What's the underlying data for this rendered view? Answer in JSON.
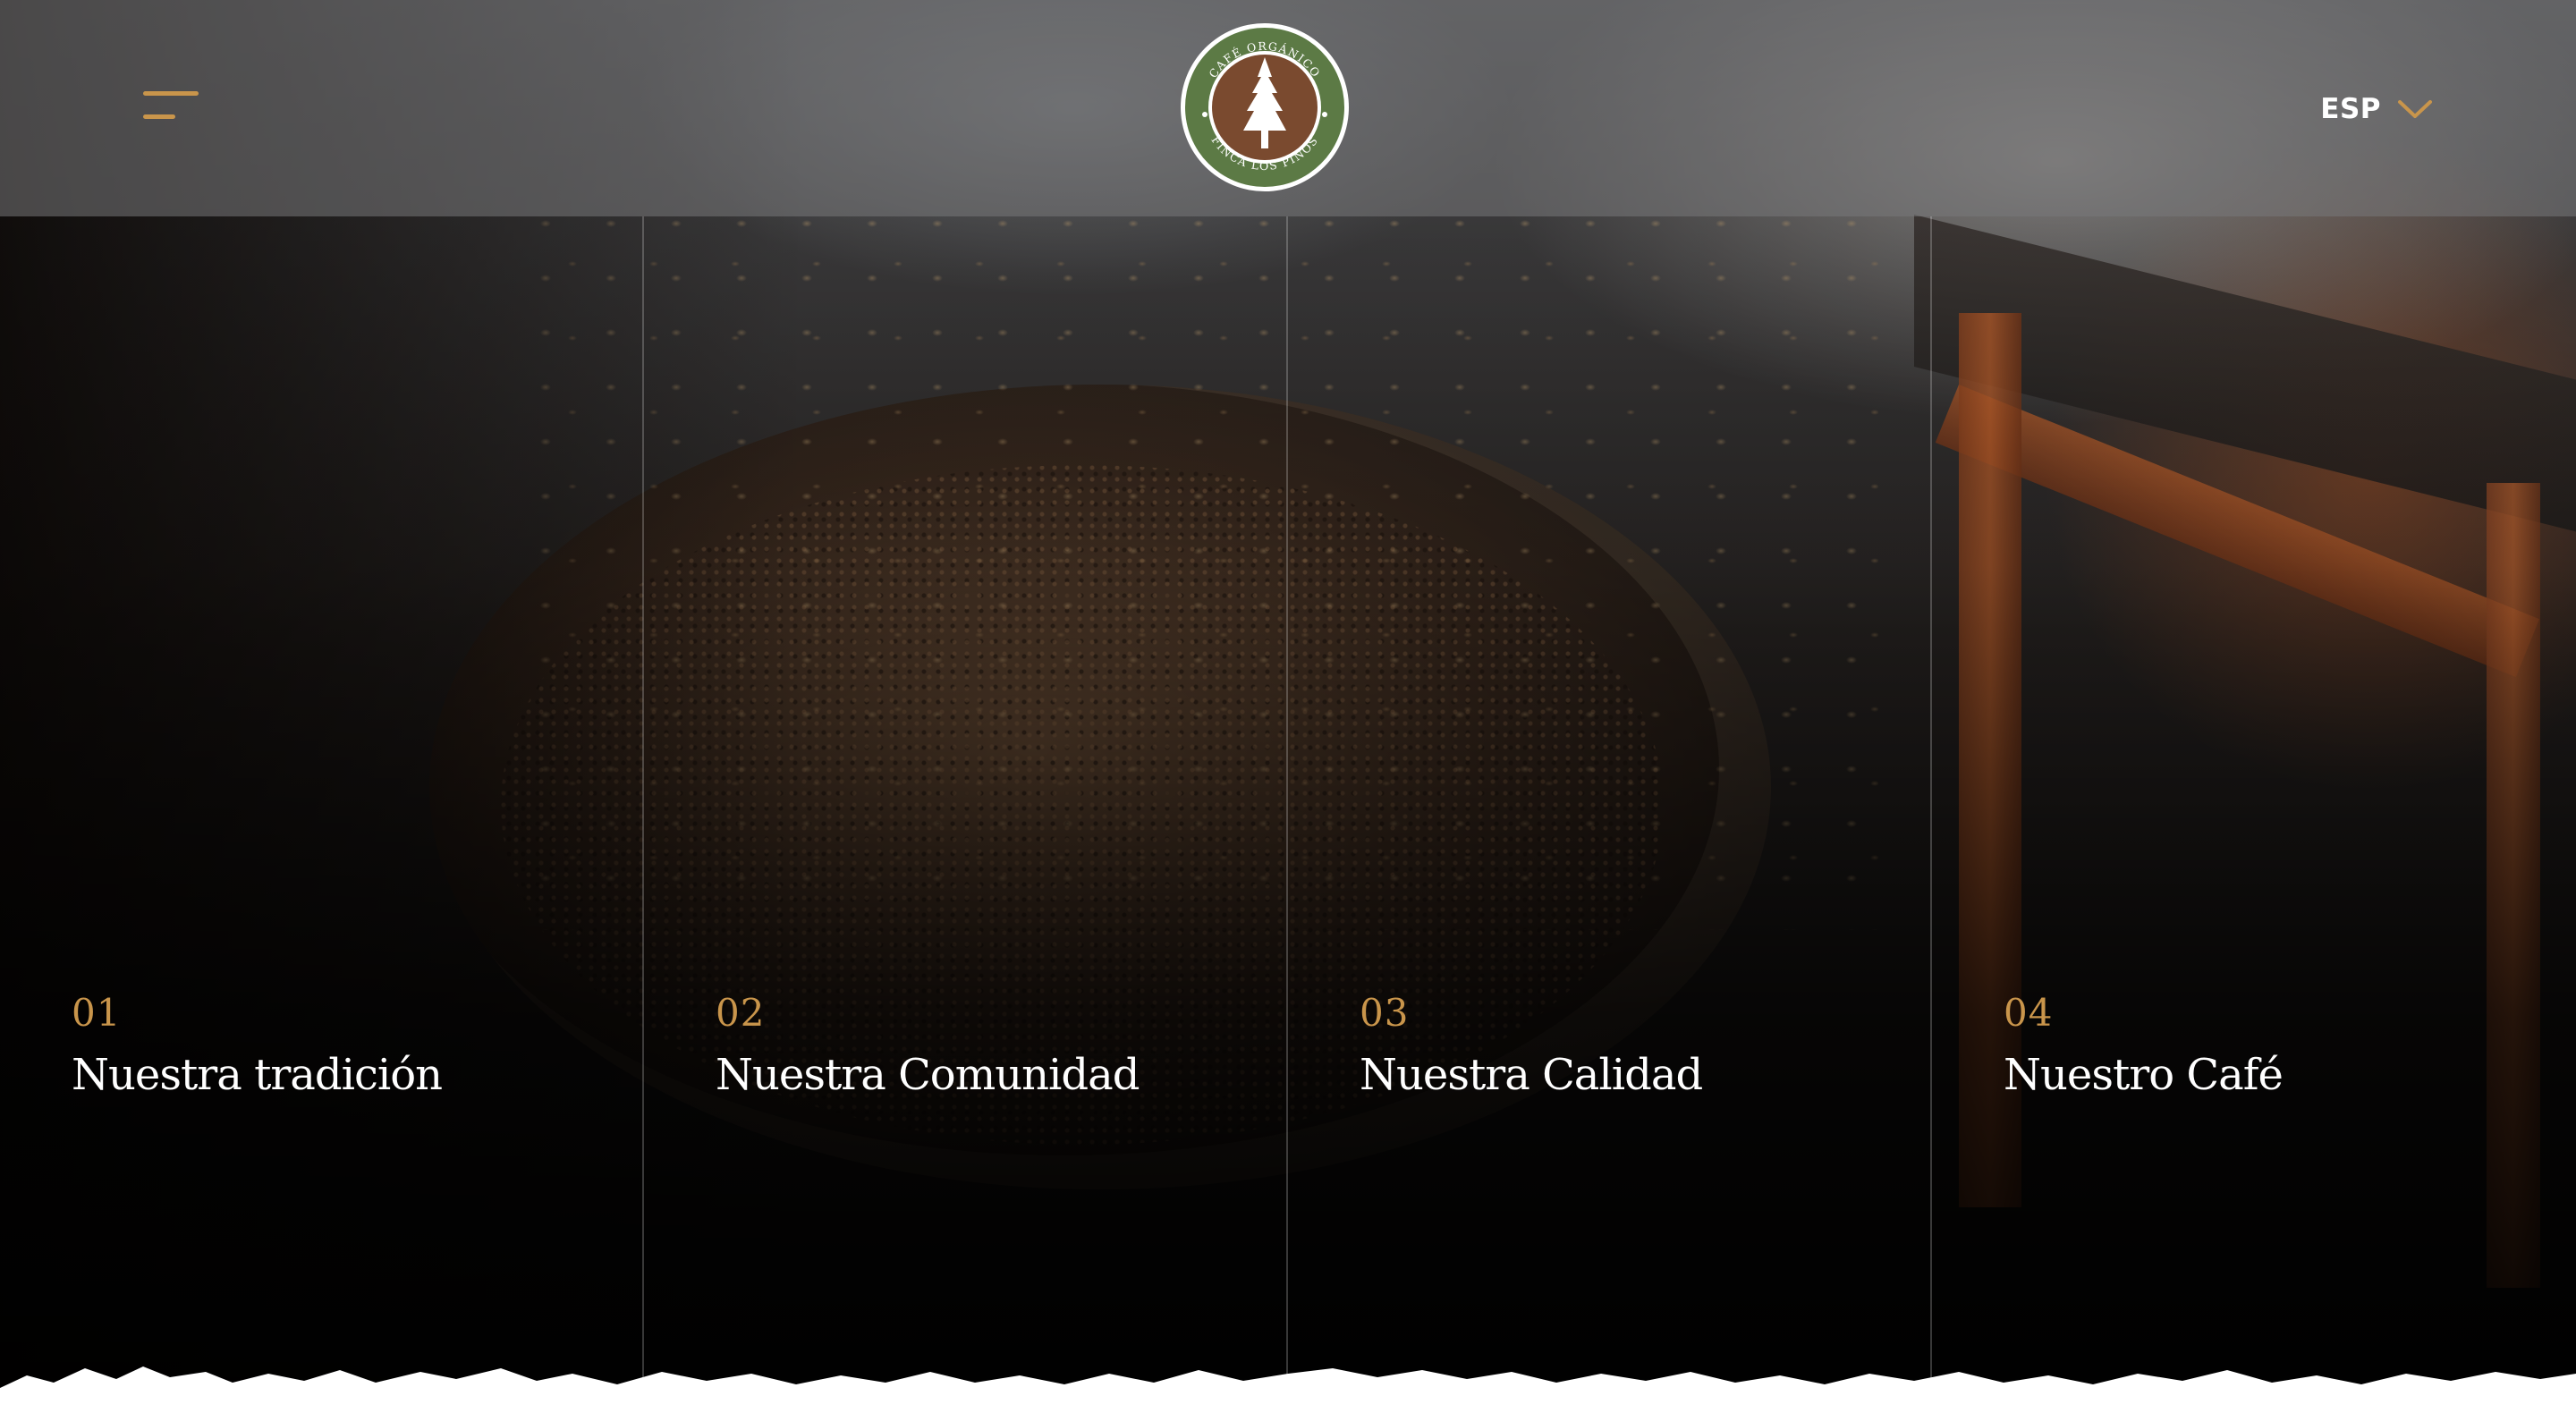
{
  "header": {
    "menu_icon": "hamburger-menu-icon",
    "logo": {
      "text_top": "CAFÉ ORGÁNICO",
      "text_bottom": "FINCA LOS PINOS",
      "icon": "pine-tree-icon",
      "colors": {
        "ring": "#5c7a45",
        "inner": "#7a4a2f",
        "tree": "#ffffff"
      }
    },
    "language": {
      "code": "ESP",
      "icon": "chevron-down-icon"
    }
  },
  "sections": [
    {
      "number": "01",
      "title": "Nuestra tradición"
    },
    {
      "number": "02",
      "title": "Nuestra Comunidad"
    },
    {
      "number": "03",
      "title": "Nuestra Calidad"
    },
    {
      "number": "04",
      "title": "Nuestro Café"
    }
  ],
  "colors": {
    "accent": "#c9954b",
    "text": "#ffffff",
    "header_overlay": "rgba(120,120,122,0.55)"
  }
}
